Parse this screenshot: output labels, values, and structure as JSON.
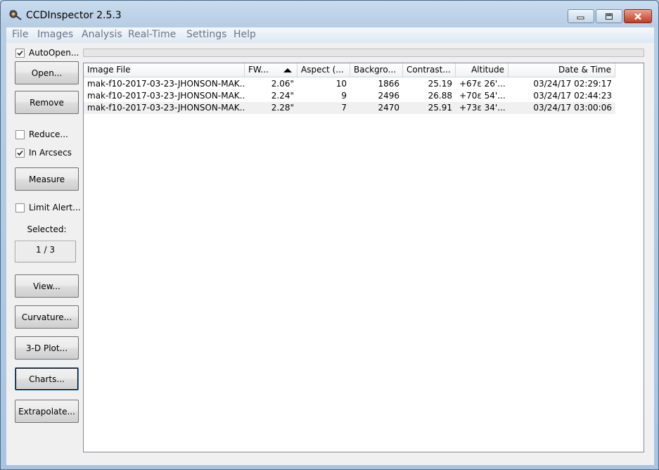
{
  "window": {
    "title": "CCDInspector 2.5.3"
  },
  "menu": [
    "File",
    "Images",
    "Analysis",
    "Real-Time",
    "Settings",
    "Help"
  ],
  "sidebar": {
    "autoopen": {
      "label": "AutoOpen...",
      "checked": true
    },
    "open_label": "Open...",
    "remove_label": "Remove",
    "reduce": {
      "label": "Reduce...",
      "checked": false
    },
    "arcsecs": {
      "label": "In Arcsecs",
      "checked": true
    },
    "measure_label": "Measure",
    "limit_alert": {
      "label": "Limit Alert...",
      "checked": false
    },
    "selected_label": "Selected:",
    "selected_value": "1 / 3",
    "view_label": "View...",
    "curvature_label": "Curvature...",
    "plot3d_label": "3-D Plot...",
    "charts_label": "Charts...",
    "extrapolate_label": "Extrapolate..."
  },
  "table": {
    "columns": [
      "Image File",
      "FW...",
      "Aspect (...",
      "Backgro...",
      "Contrast...",
      "Altitude",
      "Date & Time"
    ],
    "sort_column": "FW...",
    "rows": [
      [
        "mak-f10-2017-03-23-JHONSON-MAK...",
        "2.06\"",
        "10",
        "1866",
        "25.19",
        "+67ε 26'...",
        "03/24/17 02:29:17"
      ],
      [
        "mak-f10-2017-03-23-JHONSON-MAK...",
        "2.24\"",
        "9",
        "2496",
        "26.88",
        "+70ε 54'...",
        "03/24/17 02:44:23"
      ],
      [
        "mak-f10-2017-03-23-JHONSON-MAK...",
        "2.28\"",
        "7",
        "2470",
        "25.91",
        "+73ε 34'...",
        "03/24/17 03:00:06"
      ]
    ]
  }
}
